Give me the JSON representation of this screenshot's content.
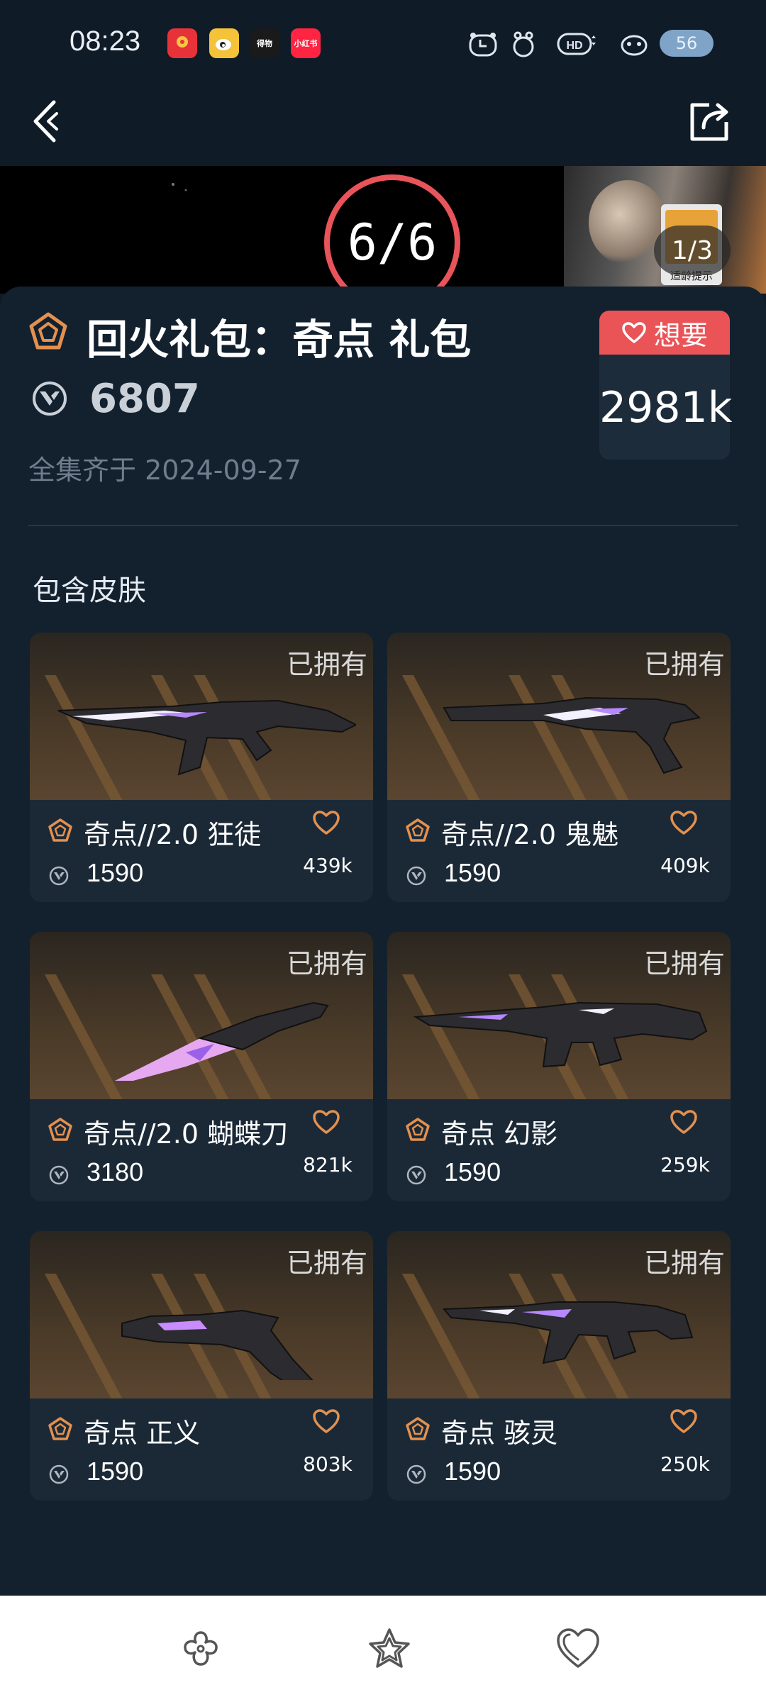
{
  "status_bar": {
    "time": "08:23",
    "apps": [
      {
        "name": "app-icon-red-pin",
        "color": "#e8323a",
        "label": ""
      },
      {
        "name": "weibo-icon",
        "color": "#f4c33a",
        "label": ""
      },
      {
        "name": "app-icon-dark",
        "color": "#1a1a1a",
        "label": "得物"
      },
      {
        "name": "xiaohongshu-icon",
        "color": "#ff2442",
        "label": "小红书"
      }
    ],
    "battery": "56"
  },
  "banner": {
    "counter": "6/6",
    "page_indicator": "1/3",
    "age_badge_text": "适龄提示"
  },
  "bundle": {
    "title": "回火礼包：奇点 礼包",
    "price": "6807",
    "collected_date": "全集齐于 2024-09-27",
    "want_label": "想要",
    "want_count": "2981k"
  },
  "section_heading": "包含皮肤",
  "skins": [
    {
      "name": "奇点//2.0 狂徒",
      "price": "1590",
      "likes": "439k",
      "owned": "已拥有",
      "weapon": "rifle"
    },
    {
      "name": "奇点//2.0 鬼魅",
      "price": "1590",
      "likes": "409k",
      "owned": "已拥有",
      "weapon": "pistol"
    },
    {
      "name": "奇点//2.0 蝴蝶刀",
      "price": "3180",
      "likes": "821k",
      "owned": "已拥有",
      "weapon": "knife"
    },
    {
      "name": "奇点 幻影",
      "price": "1590",
      "likes": "259k",
      "owned": "已拥有",
      "weapon": "rifle2"
    },
    {
      "name": "奇点 正义",
      "price": "1590",
      "likes": "803k",
      "owned": "已拥有",
      "weapon": "revolver"
    },
    {
      "name": "奇点 骇灵",
      "price": "1590",
      "likes": "250k",
      "owned": "已拥有",
      "weapon": "smg"
    }
  ],
  "colors": {
    "background": "#0f1b27",
    "panel": "#13212f",
    "card": "#1b2937",
    "accent_red": "#ea5457",
    "tier_orange": "#e3914f"
  }
}
